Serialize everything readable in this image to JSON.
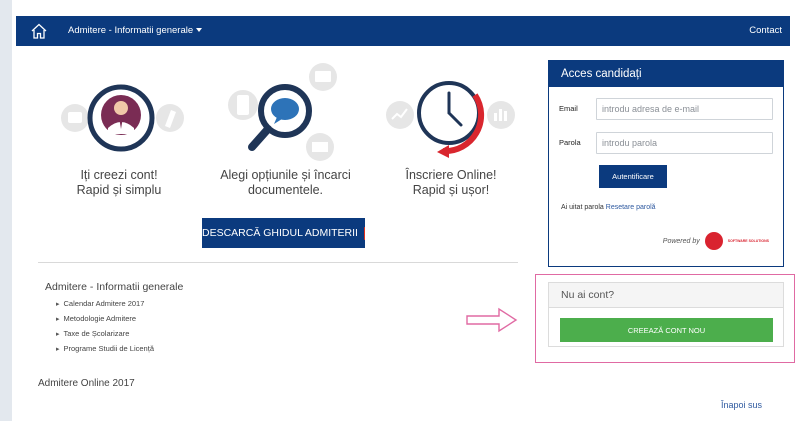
{
  "navbar": {
    "menu_label": "Admitere - Informatii generale",
    "contact_label": "Contact",
    "home_icon": "home-icon",
    "background": "#0b3a7e"
  },
  "features": [
    {
      "icon": "user-profile-icon",
      "line1": "Iți creezi cont!",
      "line2": "Rapid și simplu"
    },
    {
      "icon": "magnifier-chat-icon",
      "line1": "Alegi opțiunile și încarci",
      "line2": "documentele."
    },
    {
      "icon": "clock-icon",
      "line1": "Înscriere Online!",
      "line2": "Rapid și ușor!"
    }
  ],
  "guide_button": {
    "label": "DESCARCĂ GHIDUL ADMITERII",
    "icon": "pdf-icon"
  },
  "info": {
    "title": "Admitere - Informatii generale",
    "links": [
      "Calendar Admitere 2017",
      "Metodologie Admitere",
      "Taxe de Școlarizare",
      "Programe Studii de Licență"
    ]
  },
  "online_title": "Admitere Online 2017",
  "login": {
    "title": "Acces candidați",
    "email_label": "Email",
    "email_placeholder": "introdu adresa de e-mail",
    "password_label": "Parola",
    "password_placeholder": "introdu parola",
    "submit_label": "Autentificare",
    "forgot_text": "Ai uitat parola",
    "reset_link": "Resetare parolă",
    "powered_by": "Powered by",
    "vendor_name": "SOFTWARE SOLUTIONS"
  },
  "register": {
    "title": "Nu ai cont?",
    "button_label": "CREEAZĂ CONT NOU",
    "highlight_color": "#e06aa3",
    "button_color": "#4cae4c"
  },
  "back_to_top": "Înapoi sus"
}
